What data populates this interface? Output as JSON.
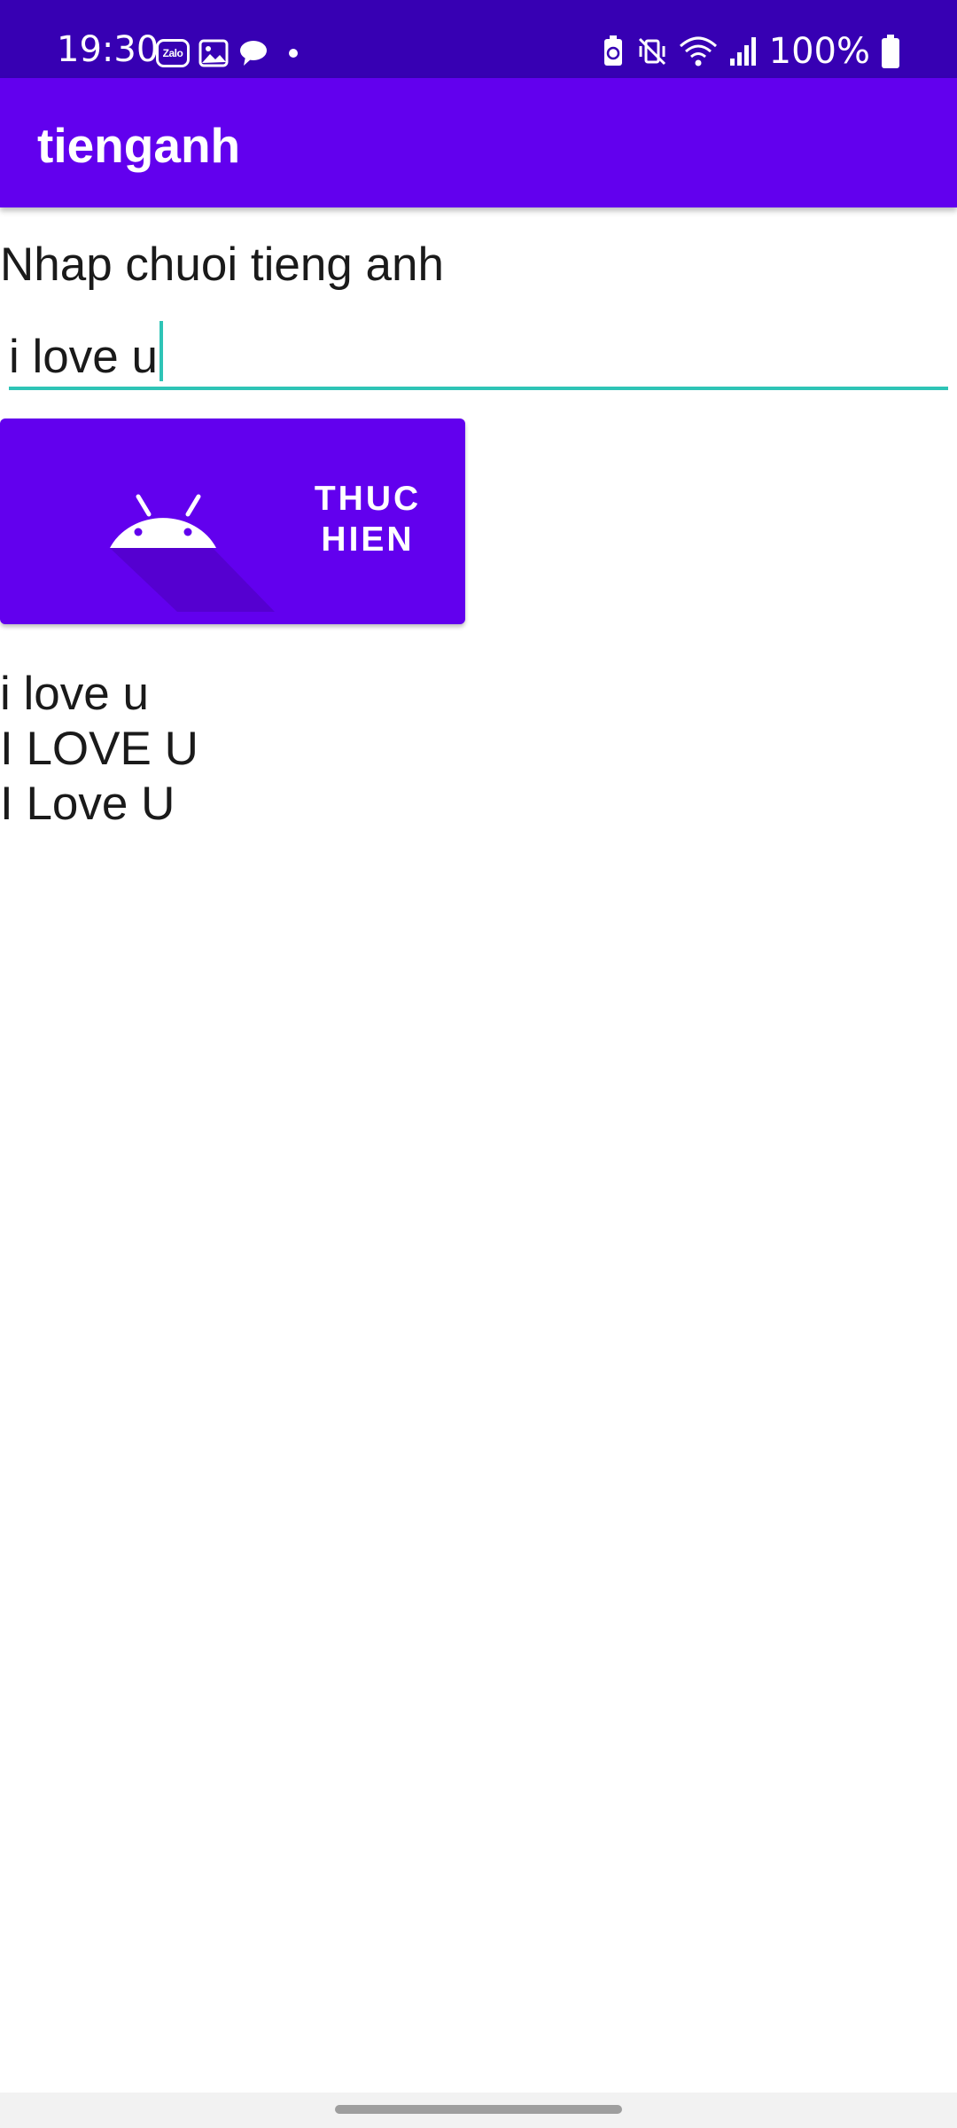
{
  "status_bar": {
    "time": "19:30",
    "zalo_label": "Zalo",
    "battery_percent": "100%",
    "icons_left": [
      "zalo-icon",
      "gallery-icon",
      "chat-bubble-icon",
      "dot-icon"
    ],
    "icons_right": [
      "battery-saver-icon",
      "vibrate-mute-icon",
      "wifi-icon",
      "signal-icon",
      "battery-icon"
    ]
  },
  "app_bar": {
    "title": "tienganh",
    "color": "#6200ee"
  },
  "form": {
    "prompt_label": "Nhap chuoi tieng anh",
    "input_value": "i love u",
    "underline_color": "#2ec4b6"
  },
  "action_button": {
    "label": "THUC HIEN",
    "icon": "android-icon",
    "color": "#6200ee"
  },
  "results": {
    "lines": [
      "i love u",
      "I LOVE U",
      "I Love U"
    ]
  }
}
